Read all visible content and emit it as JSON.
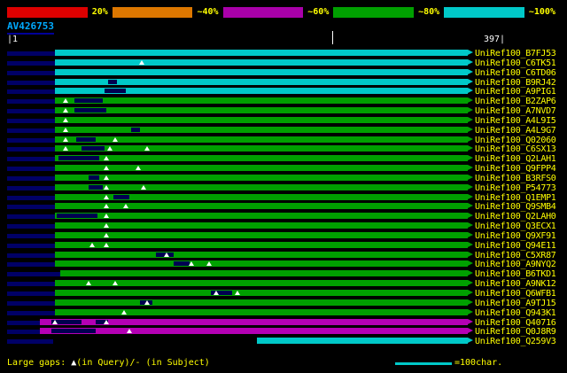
{
  "colors": {
    "background": "#000000",
    "bar_cyan": "#00c8c8",
    "bar_green": "#00a000",
    "bar_magenta": "#b400b4",
    "lead_navy": "#000066",
    "gap_dark": "#000050",
    "label_yellow": "#ffff00",
    "ruler_white": "#ffffff",
    "query_blue": "#00aaff",
    "triangle_white": "#ffffff"
  },
  "scale_bar": {
    "segments": [
      {
        "label": "20%",
        "color": "#dd0000"
      },
      {
        "label": "~40%",
        "color": "#dd7700"
      },
      {
        "label": "~60%",
        "color": "#aa00aa"
      },
      {
        "label": "~80%",
        "color": "#00a000"
      },
      {
        "label": "~100%",
        "color": "#00c8c8"
      }
    ]
  },
  "query": {
    "name": "AV426753"
  },
  "ruler": {
    "start": "|1",
    "end": "397|"
  },
  "rows": [
    {
      "label": "UniRef100_B7FJ53",
      "color": "cyan",
      "bar": [
        62,
        528
      ],
      "lead": [
        8,
        62
      ],
      "dark": [],
      "tris": []
    },
    {
      "label": "UniRef100_C6TK51",
      "color": "cyan",
      "bar": [
        62,
        528
      ],
      "lead": [
        8,
        62
      ],
      "dark": [],
      "tris": [
        160
      ]
    },
    {
      "label": "UniRef100_C6TD06",
      "color": "cyan",
      "bar": [
        62,
        528
      ],
      "lead": [
        8,
        62
      ],
      "dark": [],
      "tris": []
    },
    {
      "label": "UniRef100_B9RJ42",
      "color": "cyan",
      "bar": [
        62,
        528
      ],
      "lead": [
        8,
        62
      ],
      "dark": [
        [
          122,
          132
        ]
      ],
      "tris": []
    },
    {
      "label": "UniRef100_A9PIG1",
      "color": "cyan",
      "bar": [
        62,
        528
      ],
      "lead": [
        8,
        62
      ],
      "dark": [
        [
          118,
          142
        ]
      ],
      "tris": []
    },
    {
      "label": "UniRef100_B2ZAP6",
      "color": "green",
      "bar": [
        62,
        528
      ],
      "lead": [
        8,
        62
      ],
      "dark": [
        [
          84,
          116
        ]
      ],
      "tris": [
        74
      ]
    },
    {
      "label": "UniRef100_A7NVD7",
      "color": "green",
      "bar": [
        62,
        528
      ],
      "lead": [
        8,
        62
      ],
      "dark": [
        [
          84,
          120
        ]
      ],
      "tris": [
        74
      ]
    },
    {
      "label": "UniRef100_A4L9I5",
      "color": "green",
      "bar": [
        62,
        528
      ],
      "lead": [
        8,
        62
      ],
      "dark": [],
      "tris": [
        74
      ]
    },
    {
      "label": "UniRef100_A4L9G7",
      "color": "green",
      "bar": [
        62,
        528
      ],
      "lead": [
        8,
        62
      ],
      "dark": [
        [
          148,
          158
        ]
      ],
      "tris": [
        74
      ]
    },
    {
      "label": "UniRef100_Q02060",
      "color": "green",
      "bar": [
        62,
        528
      ],
      "lead": [
        8,
        62
      ],
      "dark": [
        [
          86,
          108
        ]
      ],
      "tris": [
        74,
        130
      ]
    },
    {
      "label": "UniRef100_C6SX13",
      "color": "green",
      "bar": [
        62,
        528
      ],
      "lead": [
        8,
        62
      ],
      "dark": [
        [
          92,
          118
        ]
      ],
      "tris": [
        74,
        124,
        166
      ]
    },
    {
      "label": "UniRef100_Q2LAH1",
      "color": "green",
      "bar": [
        62,
        528
      ],
      "lead": [
        8,
        62
      ],
      "dark": [
        [
          66,
          112
        ]
      ],
      "tris": [
        120
      ]
    },
    {
      "label": "UniRef100_Q9FPP4",
      "color": "green",
      "bar": [
        62,
        528
      ],
      "lead": [
        8,
        62
      ],
      "dark": [],
      "tris": [
        120,
        156
      ]
    },
    {
      "label": "UniRef100_B3RFS0",
      "color": "green",
      "bar": [
        62,
        528
      ],
      "lead": [
        8,
        62
      ],
      "dark": [
        [
          100,
          112
        ]
      ],
      "tris": [
        120
      ]
    },
    {
      "label": "UniRef100_P54773",
      "color": "green",
      "bar": [
        62,
        528
      ],
      "lead": [
        8,
        62
      ],
      "dark": [
        [
          100,
          116
        ]
      ],
      "tris": [
        120,
        162
      ]
    },
    {
      "label": "UniRef100_Q1EMP1",
      "color": "green",
      "bar": [
        62,
        528
      ],
      "lead": [
        8,
        62
      ],
      "dark": [
        [
          128,
          146
        ]
      ],
      "tris": [
        120
      ]
    },
    {
      "label": "UniRef100_Q9SMB4",
      "color": "green",
      "bar": [
        62,
        528
      ],
      "lead": [
        8,
        62
      ],
      "dark": [],
      "tris": [
        120,
        142
      ]
    },
    {
      "label": "UniRef100_Q2LAH0",
      "color": "green",
      "bar": [
        62,
        528
      ],
      "lead": [
        8,
        62
      ],
      "dark": [
        [
          64,
          110
        ]
      ],
      "tris": [
        120
      ]
    },
    {
      "label": "UniRef100_Q3ECX1",
      "color": "green",
      "bar": [
        62,
        528
      ],
      "lead": [
        8,
        62
      ],
      "dark": [],
      "tris": [
        120
      ]
    },
    {
      "label": "UniRef100_Q9XF91",
      "color": "green",
      "bar": [
        62,
        528
      ],
      "lead": [
        8,
        62
      ],
      "dark": [],
      "tris": [
        120
      ]
    },
    {
      "label": "UniRef100_Q94E11",
      "color": "green",
      "bar": [
        62,
        528
      ],
      "lead": [
        8,
        62
      ],
      "dark": [],
      "tris": [
        104,
        120
      ]
    },
    {
      "label": "UniRef100_C5XR87",
      "color": "green",
      "bar": [
        62,
        528
      ],
      "lead": [
        8,
        62
      ],
      "dark": [
        [
          176,
          196
        ]
      ],
      "tris": [
        188
      ]
    },
    {
      "label": "UniRef100_A9NYQ2",
      "color": "green",
      "bar": [
        62,
        528
      ],
      "lead": [
        8,
        62
      ],
      "dark": [
        [
          196,
          214
        ]
      ],
      "tris": [
        216,
        236
      ]
    },
    {
      "label": "UniRef100_B6TKD1",
      "color": "green",
      "bar": [
        68,
        528
      ],
      "lead": [
        8,
        68
      ],
      "dark": [],
      "tris": []
    },
    {
      "label": "UniRef100_A9NK12",
      "color": "green",
      "bar": [
        62,
        528
      ],
      "lead": [
        8,
        62
      ],
      "dark": [],
      "tris": [
        100,
        130
      ]
    },
    {
      "label": "UniRef100_Q6WFB1",
      "color": "green",
      "bar": [
        62,
        528
      ],
      "lead": [
        8,
        62
      ],
      "dark": [
        [
          238,
          262
        ]
      ],
      "tris": [
        244,
        268
      ]
    },
    {
      "label": "UniRef100_A9TJ15",
      "color": "green",
      "bar": [
        62,
        528
      ],
      "lead": [
        8,
        62
      ],
      "dark": [
        [
          158,
          172
        ]
      ],
      "tris": [
        166
      ]
    },
    {
      "label": "UniRef100_Q943K1",
      "color": "green",
      "bar": [
        62,
        528
      ],
      "lead": [
        8,
        62
      ],
      "dark": [],
      "tris": [
        140
      ]
    },
    {
      "label": "UniRef100_Q40716",
      "color": "magenta",
      "bar": [
        45,
        528
      ],
      "lead": [
        8,
        45
      ],
      "dark": [
        [
          58,
          92
        ],
        [
          108,
          122
        ]
      ],
      "tris": [
        62,
        120
      ]
    },
    {
      "label": "UniRef100_Q0J8R9",
      "color": "magenta",
      "bar": [
        45,
        528
      ],
      "lead": [
        8,
        45
      ],
      "dark": [
        [
          58,
          108
        ]
      ],
      "tris": [
        146
      ]
    },
    {
      "label": "UniRef100_Q259V3",
      "color": "cyan",
      "bar": [
        290,
        528
      ],
      "lead": [
        8,
        60
      ],
      "dark": [],
      "tris": []
    }
  ],
  "footer": {
    "legend_prefix": "Large gaps: ",
    "legend_triangle": "▲",
    "legend_suffix": "(in Query)/- (in Subject)",
    "scale_note": "=100char."
  }
}
